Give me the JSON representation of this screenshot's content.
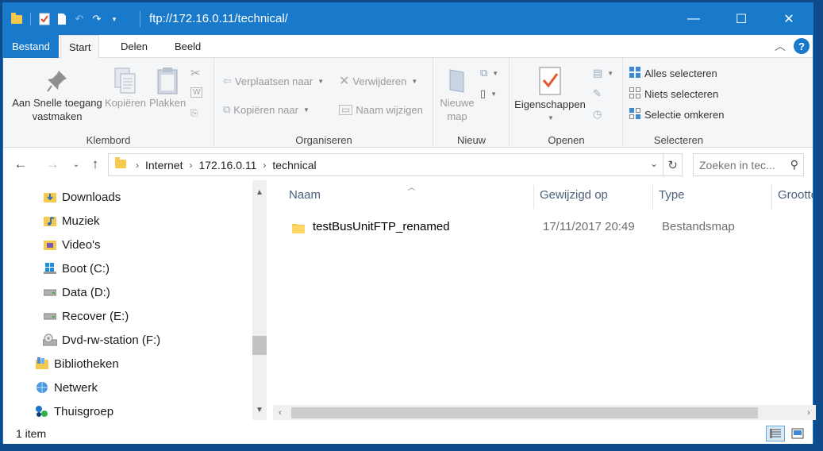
{
  "window": {
    "title": "ftp://172.16.0.11/technical/",
    "buttons": {
      "minimize": "—",
      "maximize": "☐",
      "close": "✕"
    }
  },
  "ribbon_tabs": [
    {
      "label": "Bestand"
    },
    {
      "label": "Start"
    },
    {
      "label": "Delen"
    },
    {
      "label": "Beeld"
    }
  ],
  "ribbon": {
    "klembord": {
      "label": "Klembord",
      "pin": "Aan Snelle toegang vastmaken",
      "pin_line1": "Aan Snelle toegang",
      "pin_line2": "vastmaken",
      "copy": "Kopiëren",
      "paste": "Plakken"
    },
    "organiseren": {
      "label": "Organiseren",
      "move_to": "Verplaatsen naar",
      "copy_to": "Kopiëren naar",
      "delete": "Verwijderen",
      "rename": "Naam wijzigen"
    },
    "nieuw": {
      "label": "Nieuw",
      "new_folder_line1": "Nieuwe",
      "new_folder_line2": "map"
    },
    "openen": {
      "label": "Openen",
      "properties": "Eigenschappen"
    },
    "selecteren": {
      "label": "Selecteren",
      "select_all": "Alles selecteren",
      "select_none": "Niets selecteren",
      "invert": "Selectie omkeren"
    }
  },
  "address": {
    "crumbs": [
      "Internet",
      "172.16.0.11",
      "technical"
    ]
  },
  "search": {
    "placeholder": "Zoeken in tec..."
  },
  "nav_items": [
    {
      "label": "Downloads"
    },
    {
      "label": "Muziek"
    },
    {
      "label": "Video's"
    },
    {
      "label": "Boot (C:)"
    },
    {
      "label": "Data (D:)"
    },
    {
      "label": "Recover (E:)"
    },
    {
      "label": "Dvd-rw-station (F:)"
    },
    {
      "label": "Bibliotheken"
    },
    {
      "label": "Netwerk"
    },
    {
      "label": "Thuisgroep"
    }
  ],
  "columns": {
    "name": "Naam",
    "modified": "Gewijzigd op",
    "type": "Type",
    "size": "Grootte"
  },
  "files": [
    {
      "name": "testBusUnitFTP_renamed",
      "modified": "17/11/2017 20:49",
      "type": "Bestandsmap"
    }
  ],
  "status": {
    "count": "1 item"
  },
  "colors": {
    "accent": "#1979ca",
    "folder": "#f4c94e"
  }
}
